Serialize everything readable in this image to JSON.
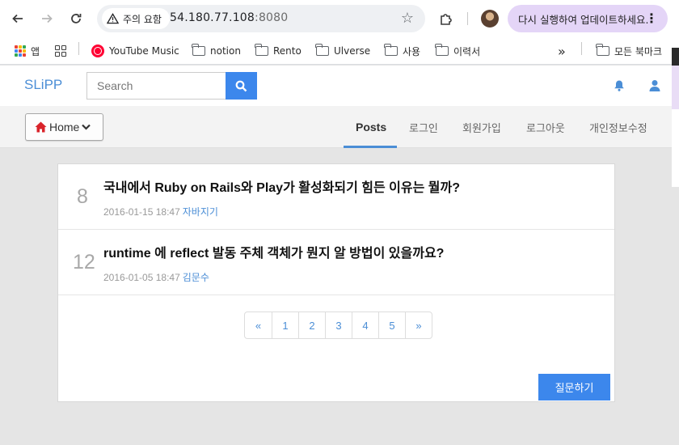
{
  "browser": {
    "address": {
      "warning_label": "주의 요함",
      "host": "54.180.77.108",
      "port": ":8080"
    },
    "update_button_label": "다시 실행하여 업데이트하세요.",
    "update_menu": "⋮",
    "bookmarks": [
      {
        "label": "앱",
        "icon": "apps-grid-icon"
      },
      {
        "label": "",
        "icon": "tab-groups-icon"
      },
      {
        "label": "YouTube Music",
        "icon": "youtube-music-icon"
      },
      {
        "label": "notion",
        "icon": "folder-icon"
      },
      {
        "label": "Rento",
        "icon": "folder-icon"
      },
      {
        "label": "Ulverse",
        "icon": "folder-icon"
      },
      {
        "label": "사용",
        "icon": "folder-icon"
      },
      {
        "label": "이력서",
        "icon": "folder-icon"
      }
    ],
    "bookmarks_overflow": "»",
    "all_bookmarks_label": "모든 북마크"
  },
  "site": {
    "brand": "SLiPP",
    "search": {
      "placeholder": "Search"
    },
    "home_button_label": "Home",
    "nav_tabs": [
      {
        "label": "Posts",
        "active": true
      },
      {
        "label": "로그인",
        "active": false
      },
      {
        "label": "회원가입",
        "active": false
      },
      {
        "label": "로그아웃",
        "active": false
      },
      {
        "label": "개인정보수정",
        "active": false
      }
    ],
    "posts": [
      {
        "count": "8",
        "title": "국내에서 Ruby on Rails와 Play가 활성화되기 힘든 이유는 뭘까?",
        "datetime": "2016-01-15 18:47",
        "author": "자바지기"
      },
      {
        "count": "12",
        "title": "runtime 에 reflect 발동 주체 객체가 뭔지 알 방법이 있을까요?",
        "datetime": "2016-01-05 18:47",
        "author": "김문수"
      }
    ],
    "pagination": [
      "«",
      "1",
      "2",
      "3",
      "4",
      "5",
      "»"
    ],
    "ask_button_label": "질문하기"
  },
  "colors": {
    "brand": "#4b8ed6",
    "primary_button": "#3c87ec",
    "update_pill": "#e4d5f7",
    "page_background": "#e5e5e5"
  }
}
